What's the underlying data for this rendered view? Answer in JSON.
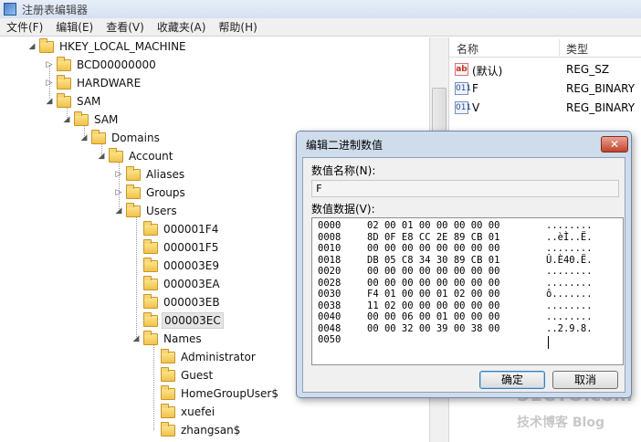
{
  "window": {
    "title": "注册表编辑器"
  },
  "menu": [
    "文件(F)",
    "编辑(E)",
    "查看(V)",
    "收藏夹(A)",
    "帮助(H)"
  ],
  "tree": [
    {
      "label": "HKEY_LOCAL_MACHINE",
      "expander": "expanded"
    },
    {
      "label": "BCD00000000",
      "expander": "collapsed"
    },
    {
      "label": "HARDWARE",
      "expander": "collapsed"
    },
    {
      "label": "SAM",
      "expander": "expanded"
    },
    {
      "label": "SAM",
      "expander": "expanded"
    },
    {
      "label": "Domains",
      "expander": "expanded"
    },
    {
      "label": "Account",
      "expander": "expanded"
    },
    {
      "label": "Aliases",
      "expander": "collapsed"
    },
    {
      "label": "Groups",
      "expander": "collapsed"
    },
    {
      "label": "Users",
      "expander": "expanded"
    },
    {
      "label": "000001F4",
      "expander": "none"
    },
    {
      "label": "000001F5",
      "expander": "none"
    },
    {
      "label": "000003E9",
      "expander": "none"
    },
    {
      "label": "000003EA",
      "expander": "none"
    },
    {
      "label": "000003EB",
      "expander": "none"
    },
    {
      "label": "000003EC",
      "expander": "none",
      "selected": true
    },
    {
      "label": "Names",
      "expander": "expanded"
    },
    {
      "label": "Administrator",
      "expander": "none"
    },
    {
      "label": "Guest",
      "expander": "none"
    },
    {
      "label": "HomeGroupUser$",
      "expander": "none"
    },
    {
      "label": "xuefei",
      "expander": "none"
    },
    {
      "label": "zhangsan$",
      "expander": "none"
    }
  ],
  "values_list": {
    "col_name": "名称",
    "col_type": "类型",
    "rows": [
      {
        "icon": "string-value-icon",
        "icon_text": "ab",
        "name": "(默认)",
        "type": "REG_SZ"
      },
      {
        "icon": "binary-value-icon",
        "icon_text": "011",
        "name": "F",
        "type": "REG_BINARY"
      },
      {
        "icon": "binary-value-icon",
        "icon_text": "011",
        "name": "V",
        "type": "REG_BINARY"
      }
    ]
  },
  "dialog": {
    "title": "编辑二进制数值",
    "close_glyph": "✕",
    "name_label": "数值名称(N):",
    "name_value": "F",
    "data_label": "数值数据(V):",
    "hex_rows": [
      {
        "addr": "0000",
        "bytes": "02 00 01 00 00 00 00 00",
        "ascii": "........"
      },
      {
        "addr": "0008",
        "bytes": "8D 0F E8 CC 2E 89 CB 01",
        "ascii": "..èÌ..Ë."
      },
      {
        "addr": "0010",
        "bytes": "00 00 00 00 00 00 00 00",
        "ascii": "........"
      },
      {
        "addr": "0018",
        "bytes": "DB 05 C8 34 30 89 CB 01",
        "ascii": "Û.È40.Ë."
      },
      {
        "addr": "0020",
        "bytes": "00 00 00 00 00 00 00 00",
        "ascii": "........"
      },
      {
        "addr": "0028",
        "bytes": "00 00 00 00 00 00 00 00",
        "ascii": "........"
      },
      {
        "addr": "0030",
        "bytes": "F4 01 00 00 01 02 00 00",
        "ascii": "ô......."
      },
      {
        "addr": "0038",
        "bytes": "11 02 00 00 00 00 00 00",
        "ascii": "........"
      },
      {
        "addr": "0040",
        "bytes": "00 00 06 00 01 00 00 00",
        "ascii": "........"
      },
      {
        "addr": "0048",
        "bytes": "00 00 32 00 39 00 38 00",
        "ascii": "..2.9.8."
      },
      {
        "addr": "0050",
        "bytes": "",
        "ascii": ""
      }
    ],
    "ok_label": "确定",
    "cancel_label": "取消"
  },
  "watermark": {
    "line1": "51CTO.com",
    "line2": "技术博客 Blog"
  }
}
